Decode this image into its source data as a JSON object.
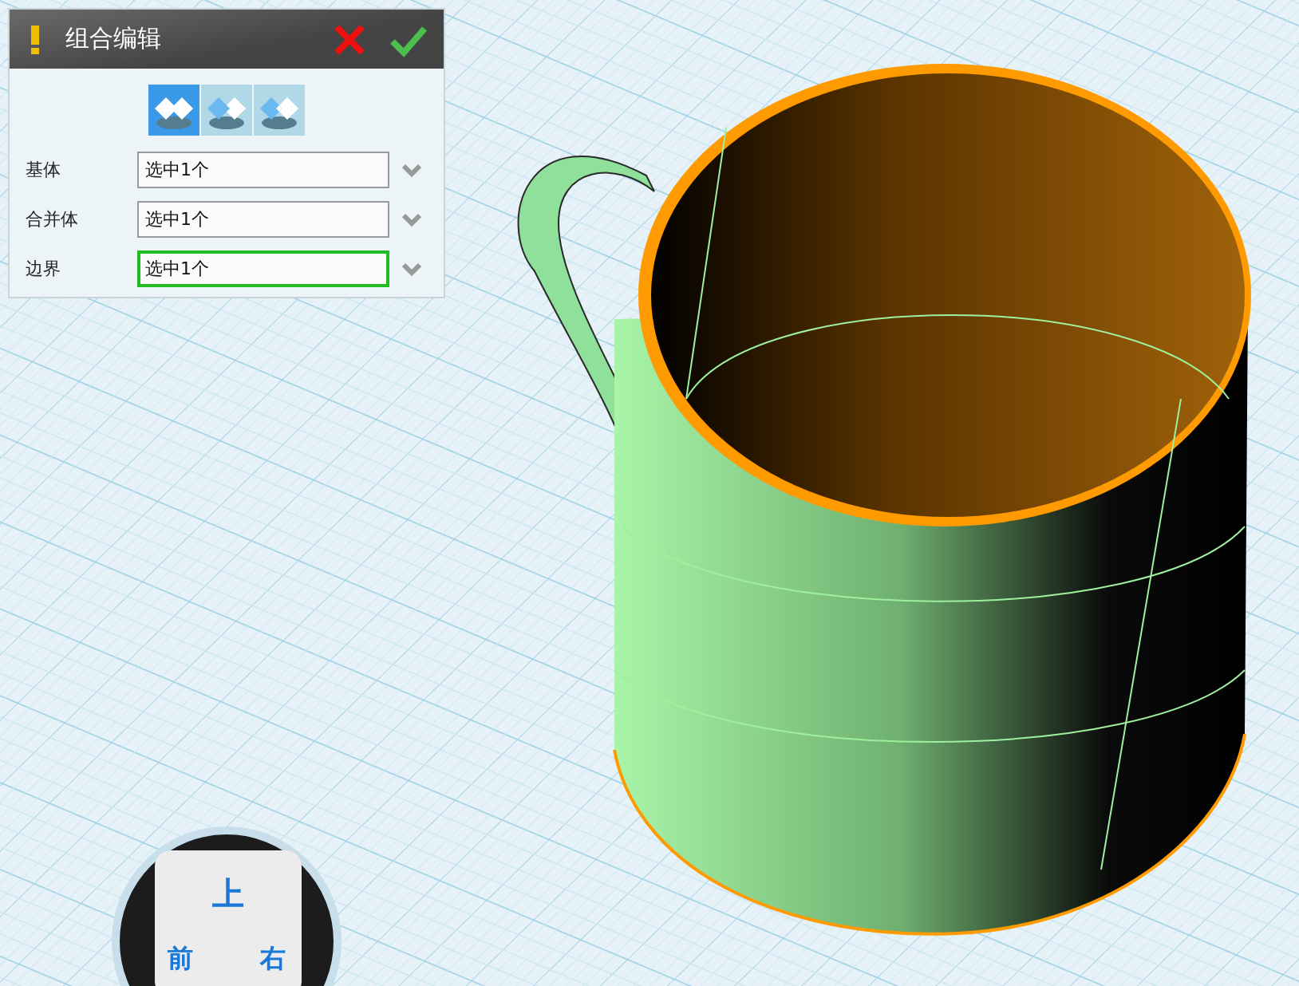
{
  "panel": {
    "title": "组合编辑",
    "modes": [
      {
        "selected": true
      },
      {
        "selected": false
      },
      {
        "selected": false
      }
    ],
    "fields": [
      {
        "label": "基体",
        "value": "选中1个",
        "focused": false
      },
      {
        "label": "合并体",
        "value": "选中1个",
        "focused": false
      },
      {
        "label": "边界",
        "value": "选中1个",
        "focused": true
      }
    ]
  },
  "view_cube": {
    "faces": [
      "上",
      "前",
      "右"
    ]
  }
}
